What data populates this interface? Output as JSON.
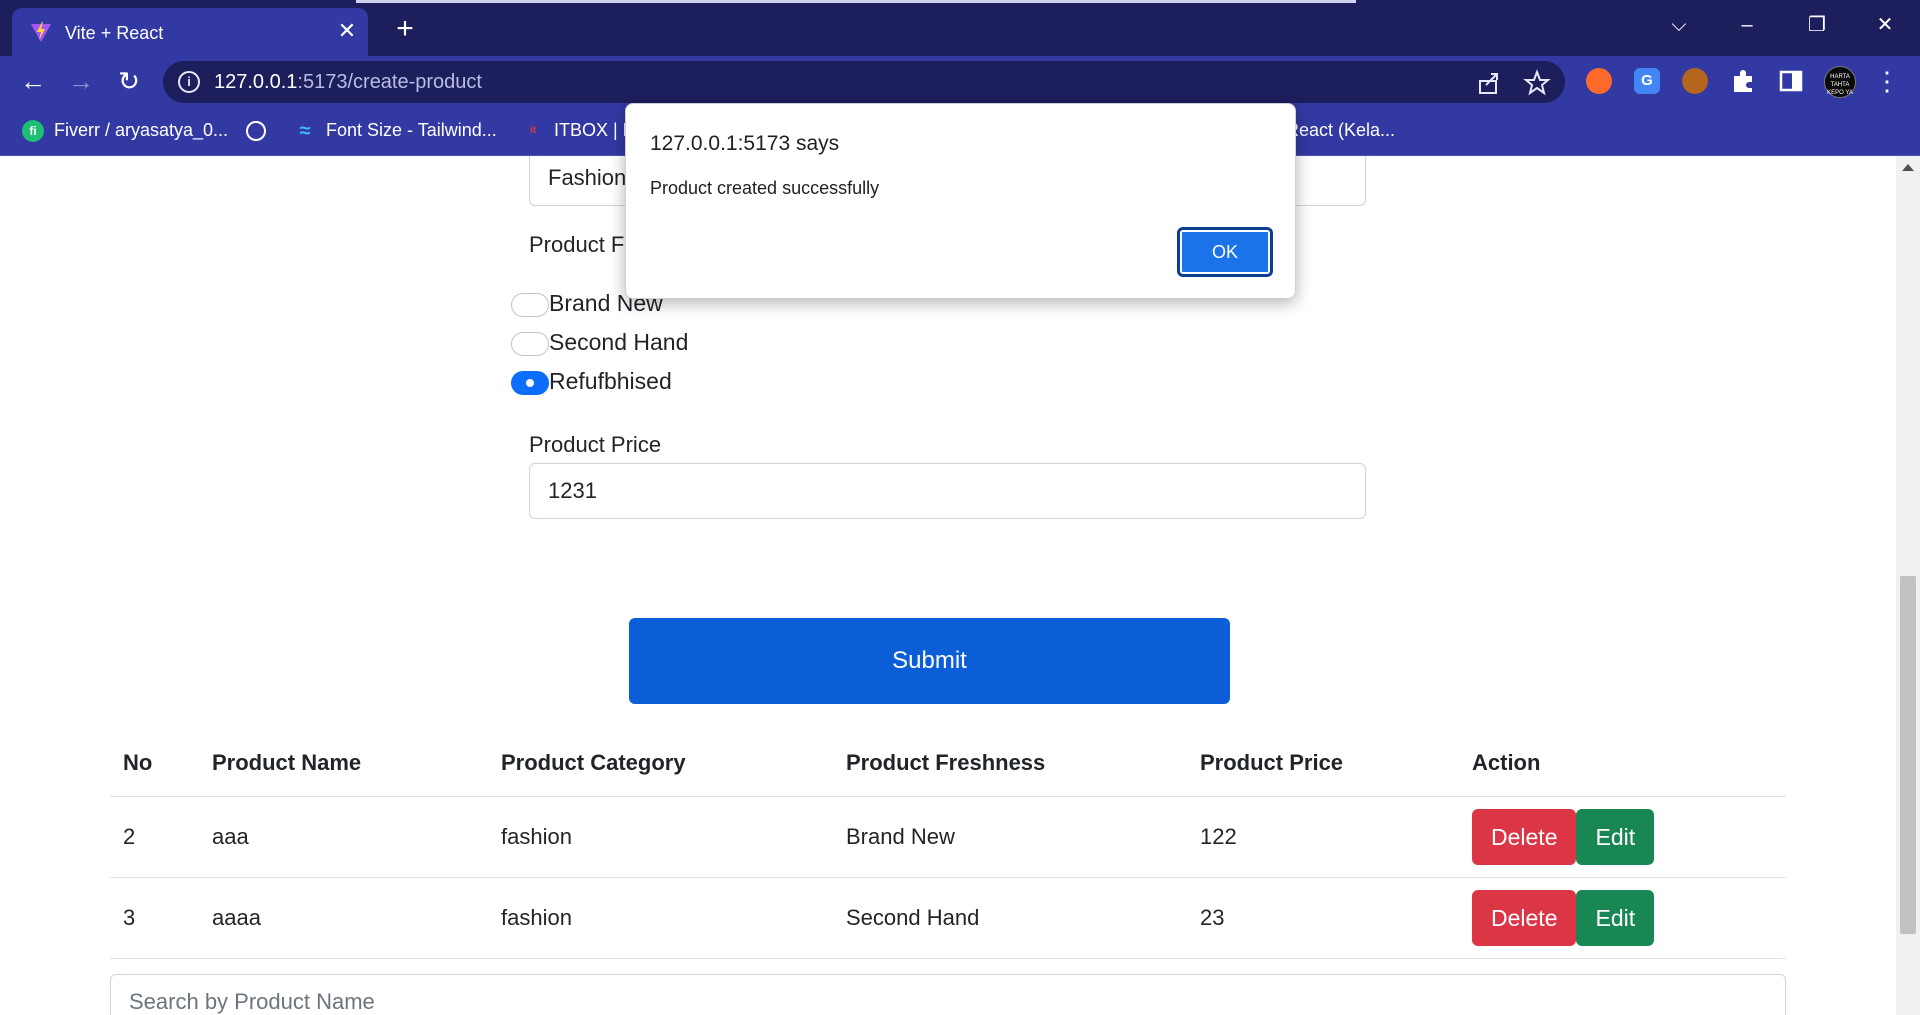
{
  "browser": {
    "tab_title": "Vite + React",
    "tab_close": "✕",
    "new_tab": "+",
    "window_controls": {
      "collapse": "⌵",
      "minimize": "–",
      "restore": "❐",
      "close": "✕"
    },
    "nav": {
      "back": "←",
      "forward": "→",
      "reload": "↻"
    },
    "url_host": "127.0.0.1",
    "url_path": ":5173/create-product",
    "menu": "⋮",
    "icons": [
      "info-icon",
      "share-icon",
      "star-icon",
      "puzzle-icon",
      "side-panel-icon"
    ],
    "extensions": [
      {
        "name": "ext-orange",
        "color": "#ff6a2b",
        "glyph": "●"
      },
      {
        "name": "ext-translate",
        "color": "#4285f4",
        "glyph": "G"
      },
      {
        "name": "ext-cookie",
        "color": "#b5651d",
        "glyph": "◕"
      }
    ],
    "avatar_text": "HARTA TAHTA KEPO YA"
  },
  "bookmarks": [
    {
      "label": "Fiverr / aryasatya_0...",
      "icon": "fiverr-icon",
      "color": "#1dbf73",
      "glyph": "fi"
    },
    {
      "label": "",
      "icon": "globe-icon",
      "color": "#ffffff",
      "glyph": ""
    },
    {
      "label": "Font Size - Tailwind...",
      "icon": "tailwind-icon",
      "color": "#38bdf8",
      "glyph": "≈"
    },
    {
      "label": "ITBOX | F",
      "icon": "itbox-icon",
      "color": "#e33",
      "glyph": "it"
    },
    {
      "label": "React (Kela...",
      "icon": "react-icon",
      "color": "#61dafb",
      "glyph": ""
    }
  ],
  "form": {
    "category_value": "Fashion",
    "freshness_label": "Product F",
    "freshness_options": [
      {
        "label": "Brand New",
        "checked": false
      },
      {
        "label": "Second Hand",
        "checked": false
      },
      {
        "label": "Refufbhised",
        "checked": true
      }
    ],
    "price_label": "Product Price",
    "price_value": "1231",
    "submit_label": "Submit"
  },
  "table": {
    "headers": [
      "No",
      "Product Name",
      "Product Category",
      "Product Freshness",
      "Product Price",
      "Action"
    ],
    "rows": [
      {
        "no": "2",
        "name": "aaa",
        "category": "fashion",
        "freshness": "Brand New",
        "price": "122"
      },
      {
        "no": "3",
        "name": "aaaa",
        "category": "fashion",
        "freshness": "Second Hand",
        "price": "23"
      }
    ],
    "delete_label": "Delete",
    "edit_label": "Edit"
  },
  "search": {
    "placeholder": "Search by Product Name"
  },
  "dialog": {
    "title": "127.0.0.1:5173 says",
    "message": "Product created successfully",
    "ok_label": "OK"
  }
}
